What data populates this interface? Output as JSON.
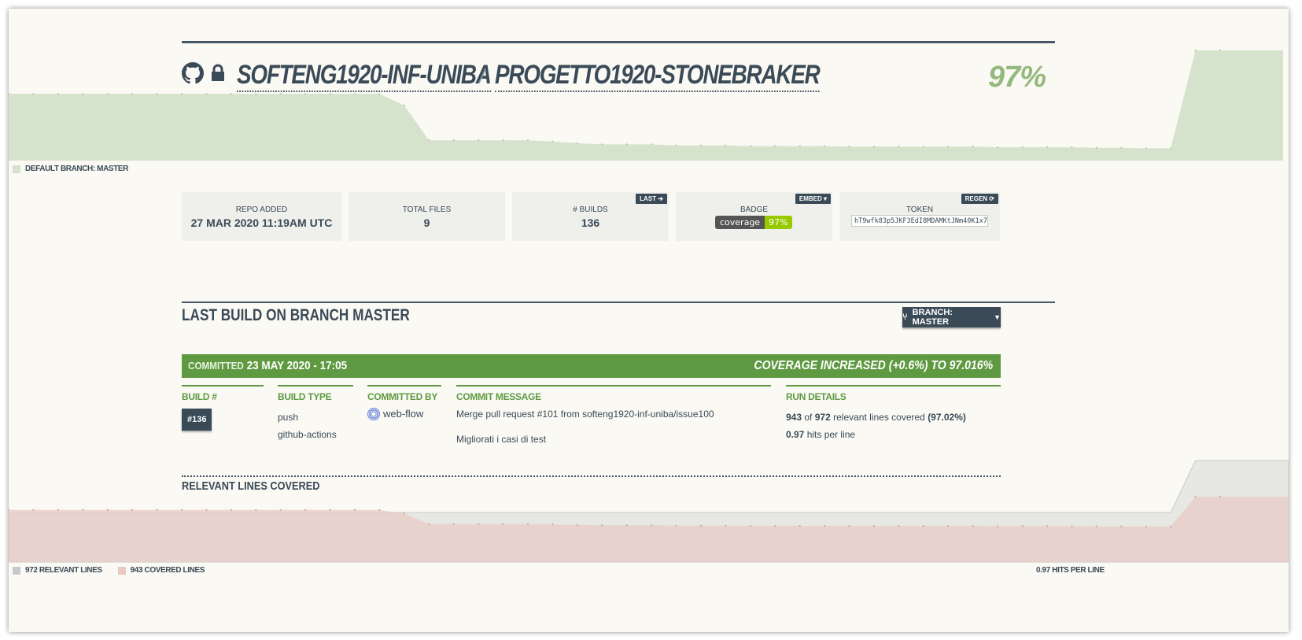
{
  "header": {
    "owner": "SOFTENG1920-INF-UNIBA",
    "separator": "/",
    "repo": "PROGETTO1920-STONEBRAKER",
    "coverage": "97%"
  },
  "top_chart": {
    "legend": "DEFAULT BRANCH: MASTER",
    "color": "#d6e3cc",
    "coverage_series": [
      89.5,
      89.5,
      89.5,
      89.5,
      89.5,
      89.5,
      89.5,
      89.5,
      89.5,
      89.5,
      89.5,
      89.5,
      89.5,
      89.5,
      89.5,
      89.5,
      87.5,
      81.5,
      81.5,
      81.5,
      81.5,
      81.5,
      81.3,
      81.0,
      80.8,
      80.8,
      80.8,
      80.6,
      80.6,
      80.6,
      80.5,
      80.5,
      80.5,
      80.5,
      80.4,
      80.4,
      80.4,
      80.4,
      80.4,
      80.4,
      80.3,
      80.3,
      80.3,
      80.3,
      80.2,
      80.2,
      80.1,
      80.1,
      97.0,
      97.0
    ]
  },
  "stats": {
    "repo_added_label": "REPO ADDED",
    "repo_added_value": "27 MAR 2020 11:19AM UTC",
    "total_files_label": "TOTAL FILES",
    "total_files_value": "9",
    "builds_label": "# BUILDS",
    "builds_value": "136",
    "builds_button": "LAST",
    "badge_label": "BADGE",
    "badge_button": "EMBED",
    "badge_left": "coverage",
    "badge_right": "97%",
    "token_label": "TOKEN",
    "token_button": "REGEN",
    "token_value": "hT9wfk83p5JKF3EdI8MDAMKtJNm40K1x7"
  },
  "last_build": {
    "title": "LAST BUILD ON BRANCH MASTER",
    "branch_button": "BRANCH: MASTER",
    "committed_label": "COMMITTED",
    "committed_date": "23 MAY 2020 - 17:05",
    "coverage_change": "COVERAGE INCREASED (+0.6%) TO 97.016%",
    "columns": {
      "build_hdr": "BUILD #",
      "build_num": "#136",
      "type_hdr": "BUILD TYPE",
      "type_1": "push",
      "type_2": "github-actions",
      "by_hdr": "COMMITTED BY",
      "by_name": "web-flow",
      "msg_hdr": "COMMIT MESSAGE",
      "msg_1": "Merge pull request #101 from softeng1920-inf-uniba/issue100",
      "msg_2": "Migliorati i casi di test",
      "run_hdr": "RUN DETAILS",
      "run_covered": "943",
      "run_of": "of",
      "run_relevant": "972",
      "run_text": "relevant lines covered",
      "run_pct": "(97.02%)",
      "run_hits": "0.97",
      "run_hits_text": "hits per line"
    }
  },
  "relevant": {
    "title": "RELEVANT LINES COVERED",
    "legend_relevant": "972 RELEVANT LINES",
    "legend_covered": "943 COVERED LINES",
    "legend_hits": "0.97 HITS PER LINE",
    "relevant_color": "#d1d3d0",
    "covered_color": "#e8c9c4"
  }
}
